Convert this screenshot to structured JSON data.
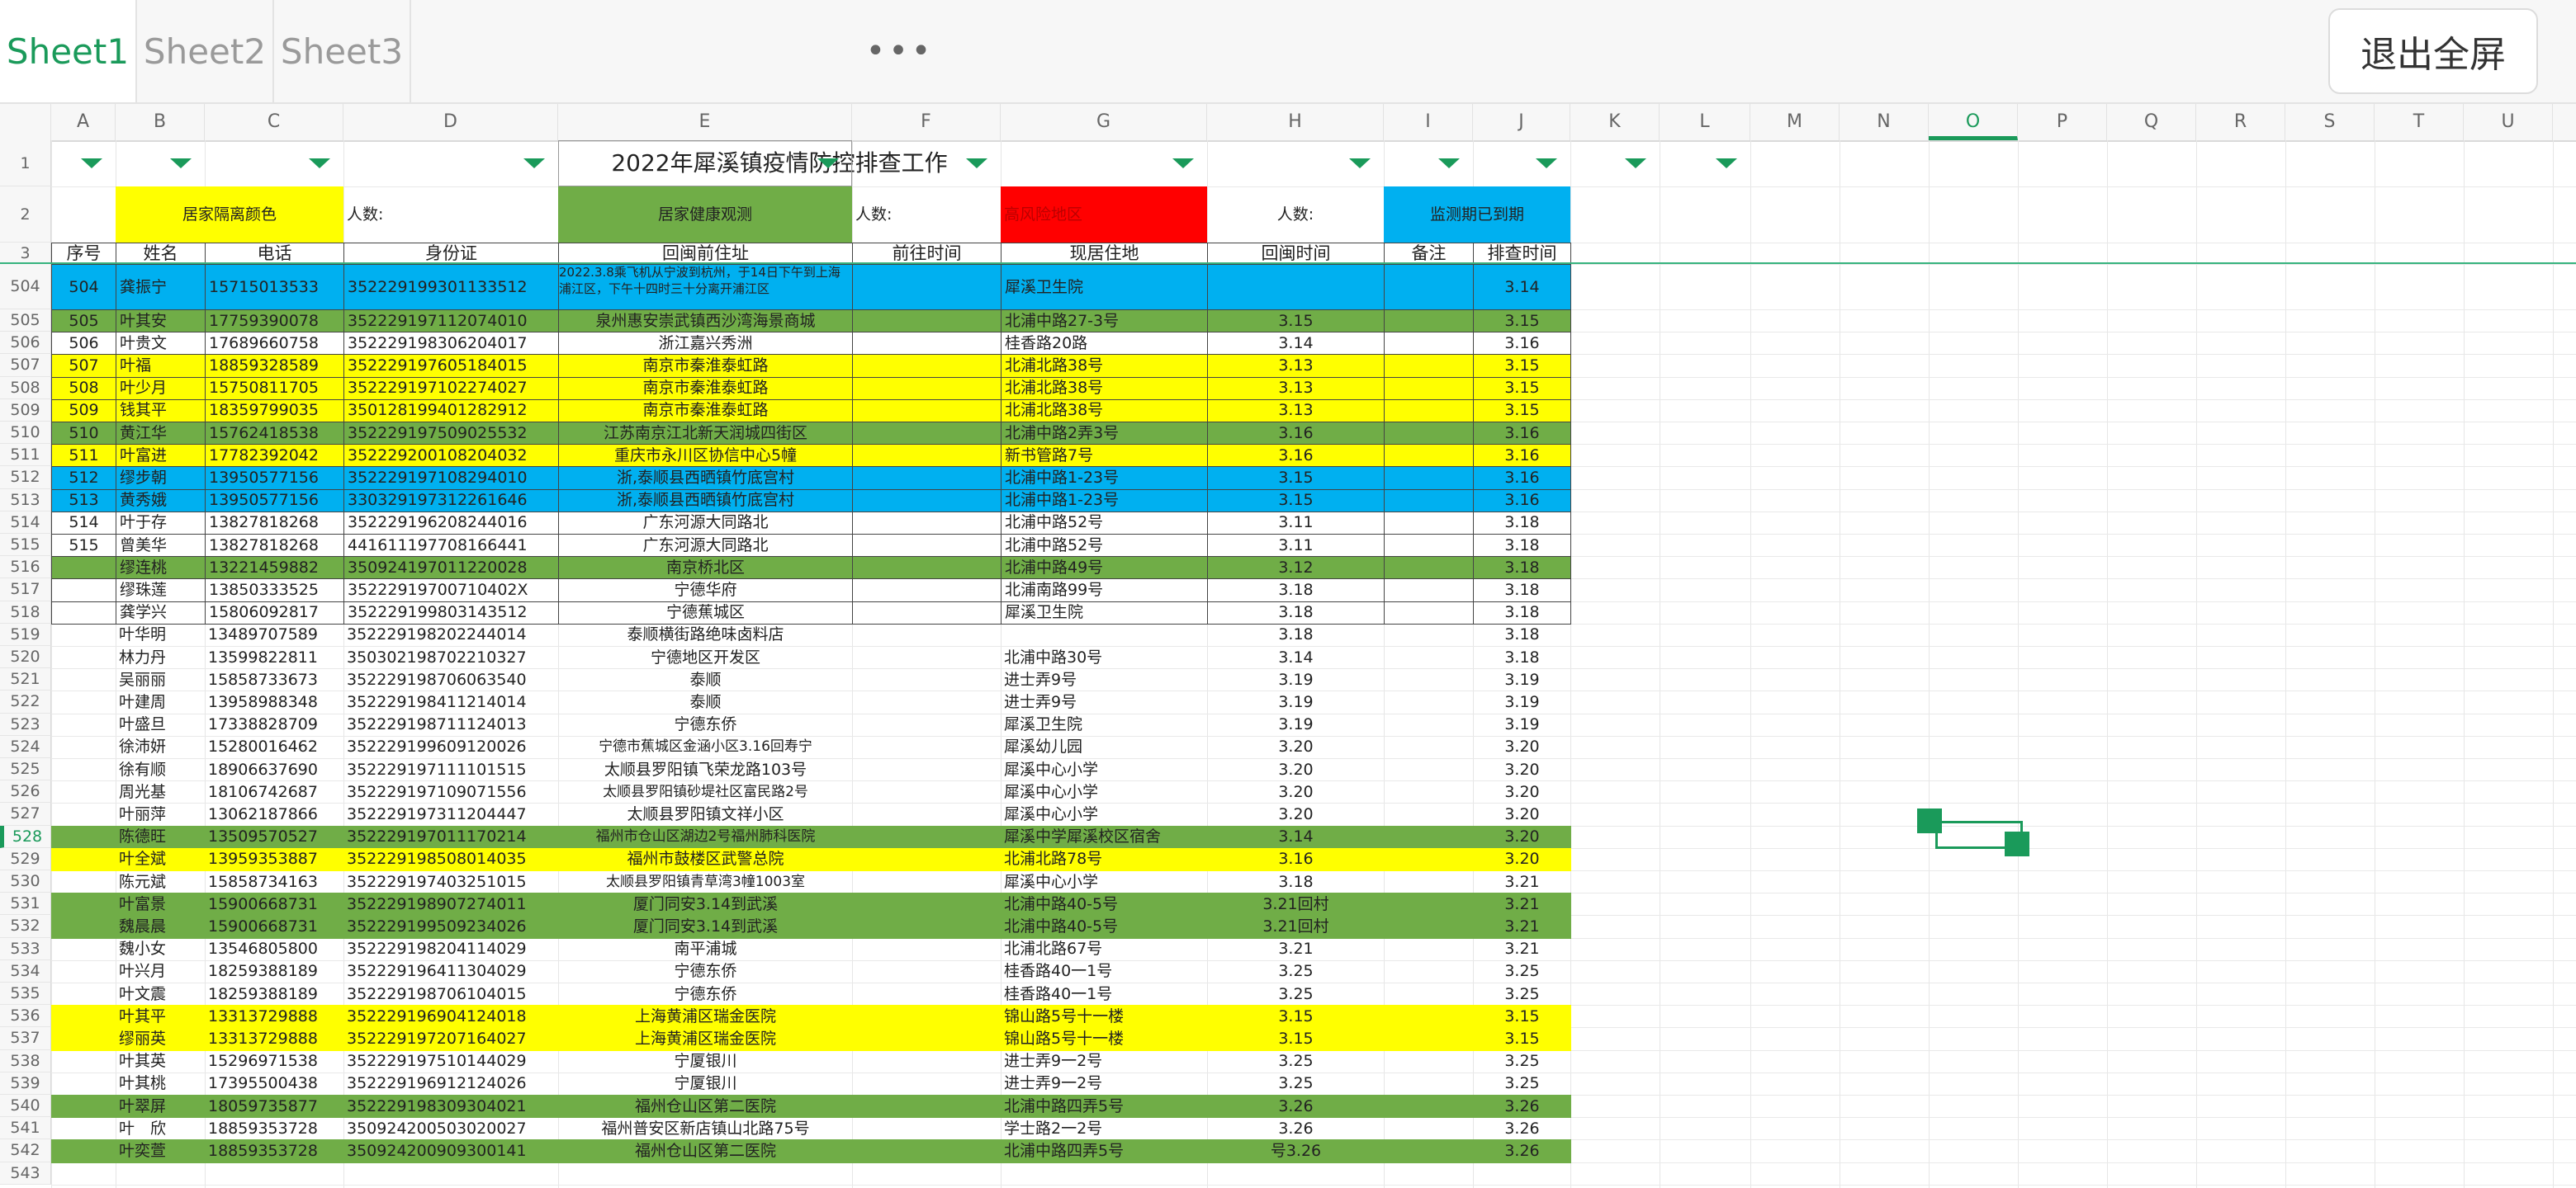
{
  "tabs": [
    {
      "label": "Sheet1",
      "active": true
    },
    {
      "label": "Sheet2",
      "active": false
    },
    {
      "label": "Sheet3",
      "active": false
    }
  ],
  "more_label": "•••",
  "exit_label": "退出全屏",
  "columns": [
    "A",
    "B",
    "C",
    "D",
    "E",
    "F",
    "G",
    "H",
    "I",
    "J",
    "K",
    "L",
    "M",
    "N",
    "O",
    "P",
    "Q",
    "R",
    "S",
    "T",
    "U"
  ],
  "selected_column": "O",
  "selected_row": "528",
  "title_row": {
    "title": "2022年犀溪镇疫情防控排查工作"
  },
  "legend_row": {
    "home_isolation": "居家隔离颜色",
    "count1": "人数:",
    "health_watch": "居家健康观测",
    "count2": "人数:",
    "high_risk": "高风险地区",
    "count3": "人数:",
    "expired": "监测期已到期"
  },
  "header_row": [
    "序号",
    "姓名",
    "电话",
    "身份证",
    "回闽前住址",
    "前往时间",
    "现居住地",
    "回闽时间",
    "备注",
    "排查时间"
  ],
  "colors": {
    "yellow": "#ffff00",
    "green": "#70ad47",
    "red": "#ff0000",
    "blue": "#00b0f0",
    "accent": "#1a9a5a"
  },
  "rows": [
    {
      "rn": "504",
      "c": "blue",
      "v": [
        "504",
        "龚振宁",
        "15715013533",
        "352229199301133512",
        "2022.3.8乘飞机从宁波到杭州，于14日下午到上海浦江区，下午十四时三十分离开浦江区",
        "",
        "犀溪卫生院",
        "",
        "",
        "3.14"
      ]
    },
    {
      "rn": "505",
      "c": "green",
      "v": [
        "505",
        "叶其安",
        "17759390078",
        "352229197112074010",
        "泉州惠安崇武镇西沙湾海景商城",
        "",
        "北浦中路27-3号",
        "3.15",
        "",
        "3.15"
      ]
    },
    {
      "rn": "506",
      "c": "",
      "v": [
        "506",
        "叶贵文",
        "17689660758",
        "352229198306204017",
        "浙江嘉兴秀洲",
        "",
        "桂香路20路",
        "3.14",
        "",
        "3.16"
      ]
    },
    {
      "rn": "507",
      "c": "yellow",
      "v": [
        "507",
        "叶福",
        "18859328589",
        "352229197605184015",
        "南京市秦淮泰虹路",
        "",
        "北浦北路38号",
        "3.13",
        "",
        "3.15"
      ]
    },
    {
      "rn": "508",
      "c": "yellow",
      "v": [
        "508",
        "叶少月",
        "15750811705",
        "352229197102274027",
        "南京市秦淮泰虹路",
        "",
        "北浦北路38号",
        "3.13",
        "",
        "3.15"
      ]
    },
    {
      "rn": "509",
      "c": "yellow",
      "v": [
        "509",
        "钱其平",
        "18359799035",
        "350128199401282912",
        "南京市秦淮泰虹路",
        "",
        "北浦北路38号",
        "3.13",
        "",
        "3.15"
      ]
    },
    {
      "rn": "510",
      "c": "green",
      "v": [
        "510",
        "黄江华",
        "15762418538",
        "352229197509025532",
        "江苏南京江北新天润城四街区",
        "",
        "北浦中路2弄3号",
        "3.16",
        "",
        "3.16"
      ]
    },
    {
      "rn": "511",
      "c": "yellow",
      "v": [
        "511",
        "叶富进",
        "17782392042",
        "352229200108204032",
        "重庆市永川区协信中心5幢",
        "",
        "新书管路7号",
        "3.16",
        "",
        "3.16"
      ]
    },
    {
      "rn": "512",
      "c": "blue",
      "v": [
        "512",
        "缪步朝",
        "13950577156",
        "352229197108294010",
        "浙,泰顺县西晒镇竹底宫村",
        "",
        "北浦中路1-23号",
        "3.15",
        "",
        "3.16"
      ]
    },
    {
      "rn": "513",
      "c": "blue",
      "v": [
        "513",
        "黄秀娥",
        "13950577156",
        "330329197312261646",
        "浙,泰顺县西晒镇竹底宫村",
        "",
        "北浦中路1-23号",
        "3.15",
        "",
        "3.16"
      ]
    },
    {
      "rn": "514",
      "c": "",
      "v": [
        "514",
        "叶于存",
        "13827818268",
        "352229196208244016",
        "广东河源大同路北",
        "",
        "北浦中路52号",
        "3.11",
        "",
        "3.18"
      ]
    },
    {
      "rn": "515",
      "c": "",
      "v": [
        "515",
        "曾美华",
        "13827818268",
        "441611197708166441",
        "广东河源大同路北",
        "",
        "北浦中路52号",
        "3.11",
        "",
        "3.18"
      ]
    },
    {
      "rn": "516",
      "c": "green",
      "v": [
        "",
        "缪连桃",
        "13221459882",
        "350924197011220028",
        "南京桥北区",
        "",
        "北浦中路49号",
        "3.12",
        "",
        "3.18"
      ]
    },
    {
      "rn": "517",
      "c": "",
      "v": [
        "",
        "缪珠莲",
        "13850333525",
        "35222919700710402X",
        "宁德华府",
        "",
        "北浦南路99号",
        "3.18",
        "",
        "3.18"
      ]
    },
    {
      "rn": "518",
      "c": "",
      "v": [
        "",
        "龚学兴",
        "15806092817",
        "352229199803143512",
        "宁德蕉城区",
        "",
        "犀溪卫生院",
        "3.18",
        "",
        "3.18"
      ]
    },
    {
      "rn": "519",
      "c": "",
      "v": [
        "",
        "叶华明",
        "13489707589",
        "352229198202244014",
        "泰顺横街路绝味卤料店",
        "",
        "",
        "3.18",
        "",
        "3.18"
      ]
    },
    {
      "rn": "520",
      "c": "",
      "v": [
        "",
        "林力丹",
        "13599822811",
        "350302198702210327",
        "宁德地区开发区",
        "",
        "北浦中路30号",
        "3.14",
        "",
        "3.18"
      ]
    },
    {
      "rn": "521",
      "c": "",
      "v": [
        "",
        "吴丽丽",
        "15858733673",
        "352229198706063540",
        "泰顺",
        "",
        "进士弄9号",
        "3.19",
        "",
        "3.19"
      ]
    },
    {
      "rn": "522",
      "c": "",
      "v": [
        "",
        "叶建周",
        "13958988348",
        "352229198411214014",
        "泰顺",
        "",
        "进士弄9号",
        "3.19",
        "",
        "3.19"
      ]
    },
    {
      "rn": "523",
      "c": "",
      "v": [
        "",
        "叶盛旦",
        "17338828709",
        "352229198711124013",
        "宁德东侨",
        "",
        "犀溪卫生院",
        "3.19",
        "",
        "3.19"
      ]
    },
    {
      "rn": "524",
      "c": "",
      "v": [
        "",
        "徐沛妍",
        "15280016462",
        "352229199609120026",
        "宁德市蕉城区金涵小区3.16回寿宁",
        "",
        "犀溪幼儿园",
        "3.20",
        "",
        "3.20"
      ]
    },
    {
      "rn": "525",
      "c": "",
      "v": [
        "",
        "徐有顺",
        "18906637690",
        "352229197111101515",
        "太顺县罗阳镇飞荣龙路103号",
        "",
        "犀溪中心小学",
        "3.20",
        "",
        "3.20"
      ]
    },
    {
      "rn": "526",
      "c": "",
      "v": [
        "",
        "周光基",
        "18106742687",
        "352229197109071556",
        "太顺县罗阳镇砂堤社区富民路2号",
        "",
        "犀溪中心小学",
        "3.20",
        "",
        "3.20"
      ]
    },
    {
      "rn": "527",
      "c": "",
      "v": [
        "",
        "叶丽萍",
        "13062187866",
        "352229197311204447",
        "太顺县罗阳镇文祥小区",
        "",
        "犀溪中心小学",
        "3.20",
        "",
        "3.20"
      ]
    },
    {
      "rn": "528",
      "c": "green",
      "v": [
        "",
        "陈德旺",
        "13509570527",
        "352229197011170214",
        "福州市仓山区湖边2号福州肺科医院",
        "",
        "犀溪中学犀溪校区宿舍",
        "3.14",
        "",
        "3.20"
      ]
    },
    {
      "rn": "529",
      "c": "yellow",
      "v": [
        "",
        "叶全斌",
        "13959353887",
        "352229198508014035",
        "福州市鼓楼区武警总院",
        "",
        "北浦北路78号",
        "3.16",
        "",
        "3.20"
      ]
    },
    {
      "rn": "530",
      "c": "",
      "v": [
        "",
        "陈元斌",
        "15858734163",
        "352229197403251015",
        "太顺县罗阳镇青草湾3幢1003室",
        "",
        "犀溪中心小学",
        "3.18",
        "",
        "3.21"
      ]
    },
    {
      "rn": "531",
      "c": "green",
      "v": [
        "",
        "叶富景",
        "15900668731",
        "352229198907274011",
        "厦门同安3.14到武溪",
        "",
        "北浦中路40-5号",
        "3.21回村",
        "",
        "3.21"
      ]
    },
    {
      "rn": "532",
      "c": "green",
      "v": [
        "",
        "魏晨晨",
        "15900668731",
        "352229199509234026",
        "厦门同安3.14到武溪",
        "",
        "北浦中路40-5号",
        "3.21回村",
        "",
        "3.21"
      ]
    },
    {
      "rn": "533",
      "c": "",
      "v": [
        "",
        "魏小女",
        "13546805800",
        "352229198204114029",
        "南平浦城",
        "",
        "北浦北路67号",
        "3.21",
        "",
        "3.21"
      ]
    },
    {
      "rn": "534",
      "c": "",
      "v": [
        "",
        "叶兴月",
        "18259388189",
        "352229196411304029",
        "宁德东侨",
        "",
        "桂香路40一1号",
        "3.25",
        "",
        "3.25"
      ]
    },
    {
      "rn": "535",
      "c": "",
      "v": [
        "",
        "叶文震",
        "18259388189",
        "352229198706104015",
        "宁德东侨",
        "",
        "桂香路40一1号",
        "3.25",
        "",
        "3.25"
      ]
    },
    {
      "rn": "536",
      "c": "yellow",
      "v": [
        "",
        "叶其平",
        "13313729888",
        "352229196904124018",
        "上海黄浦区瑞金医院",
        "",
        "锦山路5号十一楼",
        "3.15",
        "",
        "3.15"
      ]
    },
    {
      "rn": "537",
      "c": "yellow",
      "v": [
        "",
        "缪丽英",
        "13313729888",
        "352229197207164027",
        "上海黄浦区瑞金医院",
        "",
        "锦山路5号十一楼",
        "3.15",
        "",
        "3.15"
      ]
    },
    {
      "rn": "538",
      "c": "",
      "v": [
        "",
        "叶其英",
        "15296971538",
        "352229197510144029",
        "宁厦银川",
        "",
        "进士弄9一2号",
        "3.25",
        "",
        "3.25"
      ]
    },
    {
      "rn": "539",
      "c": "",
      "v": [
        "",
        "叶其桃",
        "17395500438",
        "352229196912124026",
        "宁厦银川",
        "",
        "进士弄9一2号",
        "3.25",
        "",
        "3.25"
      ]
    },
    {
      "rn": "540",
      "c": "green",
      "v": [
        "",
        "叶翠屏",
        "18059735877",
        "352229198309304021",
        "福州仓山区第二医院",
        "",
        "北浦中路四弄5号",
        "3.26",
        "",
        "3.26"
      ]
    },
    {
      "rn": "541",
      "c": "",
      "v": [
        "",
        "叶　欣",
        "18859353728",
        "350924200503020027",
        "福州普安区新店镇山北路75号",
        "",
        "学士路2一2号",
        "3.26",
        "",
        "3.26"
      ]
    },
    {
      "rn": "542",
      "c": "green",
      "v": [
        "",
        "叶奕萱",
        "18859353728",
        "350924200909300141",
        "福州仓山区第二医院",
        "",
        "北浦中路四弄5号",
        "号3.26",
        "",
        "3.26"
      ]
    },
    {
      "rn": "543",
      "c": "",
      "v": [
        "",
        "",
        "",
        "",
        "",
        "",
        "",
        "",
        "",
        ""
      ]
    }
  ]
}
